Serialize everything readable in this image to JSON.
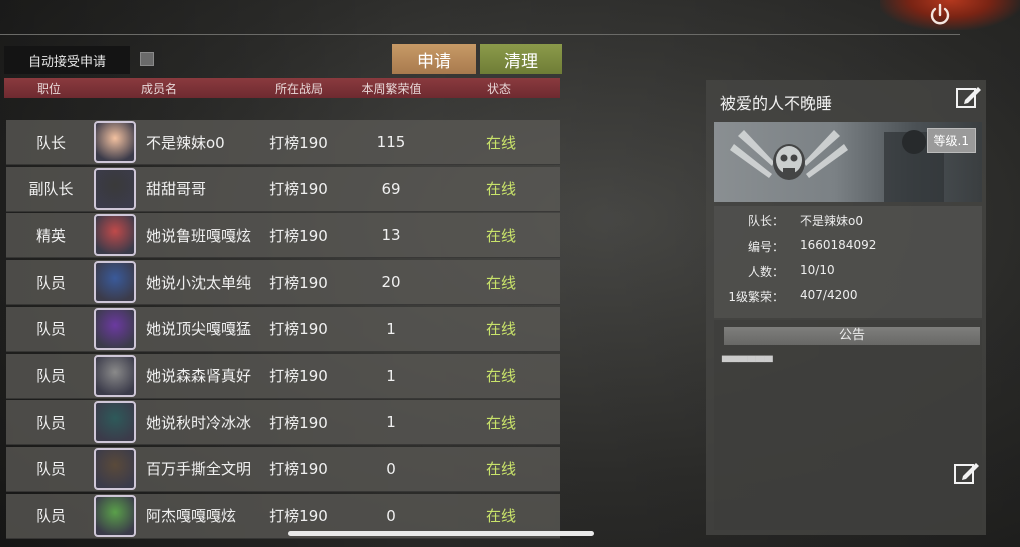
{
  "auto_accept": {
    "label": "自动接受申请",
    "checked": false
  },
  "buttons": {
    "apply": "申请",
    "clean": "清理"
  },
  "columns": {
    "role": "职位",
    "member": "成员名",
    "battle": "所在战局",
    "prosperity": "本周繁荣值",
    "status": "状态"
  },
  "members": [
    {
      "role": "队长",
      "name": "不是辣妹o0",
      "battle": "打榜190",
      "prosperity": "115",
      "status": "在线"
    },
    {
      "role": "副队长",
      "name": "甜甜哥哥",
      "battle": "打榜190",
      "prosperity": "69",
      "status": "在线"
    },
    {
      "role": "精英",
      "name": "她说鲁班嘎嘎炫",
      "battle": "打榜190",
      "prosperity": "13",
      "status": "在线"
    },
    {
      "role": "队员",
      "name": "她说小沈太单纯",
      "battle": "打榜190",
      "prosperity": "20",
      "status": "在线"
    },
    {
      "role": "队员",
      "name": "她说顶尖嘎嘎猛",
      "battle": "打榜190",
      "prosperity": "1",
      "status": "在线"
    },
    {
      "role": "队员",
      "name": "她说森森肾真好",
      "battle": "打榜190",
      "prosperity": "1",
      "status": "在线"
    },
    {
      "role": "队员",
      "name": "她说秋时冷冰冰",
      "battle": "打榜190",
      "prosperity": "1",
      "status": "在线"
    },
    {
      "role": "队员",
      "name": "百万手撕全文明",
      "battle": "打榜190",
      "prosperity": "0",
      "status": "在线"
    },
    {
      "role": "队员",
      "name": "阿杰嘎嘎嘎炫",
      "battle": "打榜190",
      "prosperity": "0",
      "status": "在线"
    }
  ],
  "team": {
    "name": "被爱的人不晚睡",
    "level": "等级.1",
    "leader_label": "队长：",
    "leader": "不是辣妹o0",
    "id_label": "编号：",
    "id": "1660184092",
    "count_label": "人数：",
    "count": "10/10",
    "prosperity_label": "1级繁荣：",
    "prosperity": "407/4200",
    "notice_label": "公告",
    "notice_text": "▀▀▀▀▀▀"
  },
  "icons": {
    "power": "power-icon",
    "edit": "edit-icon",
    "emblem": "skull-wings-emblem"
  },
  "colors": {
    "status_online": "#c9e36a",
    "header": "#7a3035",
    "apply": "#b88a5a",
    "clean": "#7f8d40"
  }
}
